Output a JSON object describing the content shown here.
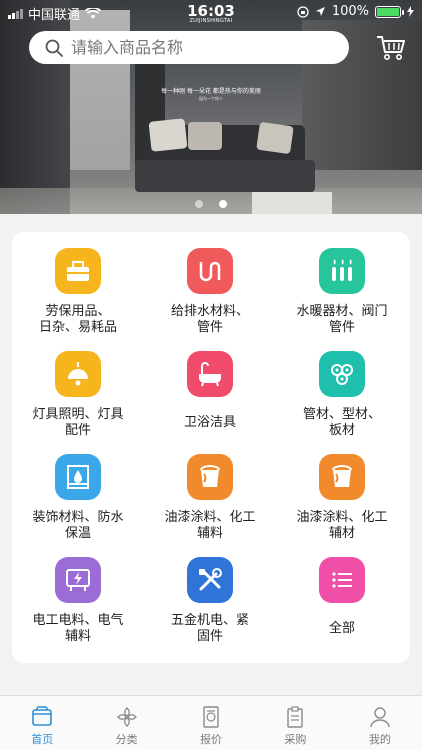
{
  "status_bar": {
    "carrier": "中国联通",
    "time": "16:03",
    "subtitle": "ZUIJINSHINGTAI",
    "battery": "100%"
  },
  "search": {
    "placeholder": "请输入商品名称"
  },
  "banner": {
    "caption_line1": "每一种刚 每一朵花 都是热与你的美丽",
    "caption_line2": "因为一个你人",
    "slides_total": 2,
    "active_slide": 2
  },
  "categories": [
    {
      "label": "劳保用品、\n日杂、易耗品",
      "icon": "toolbox-icon",
      "color": "#f7b51d"
    },
    {
      "label": "给排水材料、\n管件",
      "icon": "pipe-icon",
      "color": "#f05a5a"
    },
    {
      "label": "水暖器材、阀门\n管件",
      "icon": "radiator-icon",
      "color": "#27c59c"
    },
    {
      "label": "灯具照明、灯具\n配件",
      "icon": "lamp-icon",
      "color": "#f7b51d"
    },
    {
      "label": "卫浴洁具",
      "icon": "bathtub-icon",
      "color": "#f04b6a"
    },
    {
      "label": "管材、型材、\n板材",
      "icon": "pipes-bundle-icon",
      "color": "#1fbfae"
    },
    {
      "label": "装饰材料、防水\n保温",
      "icon": "panel-icon",
      "color": "#3aa8e8"
    },
    {
      "label": "油漆涂料、化工\n辅料",
      "icon": "paint-bucket-icon",
      "color": "#f08a2c"
    },
    {
      "label": "油漆涂料、化工\n辅材",
      "icon": "paint-bucket-icon",
      "color": "#f08a2c"
    },
    {
      "label": "电工电料、电气\n辅料",
      "icon": "electric-board-icon",
      "color": "#9b6bd6"
    },
    {
      "label": "五金机电、紧\n固件",
      "icon": "tools-icon",
      "color": "#2f74d6"
    },
    {
      "label": "全部",
      "icon": "list-icon",
      "color": "#f04fa8"
    }
  ],
  "nav": [
    {
      "label": "首页",
      "icon": "home-icon",
      "active": true
    },
    {
      "label": "分类",
      "icon": "category-icon",
      "active": false
    },
    {
      "label": "报价",
      "icon": "quote-icon",
      "active": false
    },
    {
      "label": "采购",
      "icon": "purchase-icon",
      "active": false
    },
    {
      "label": "我的",
      "icon": "profile-icon",
      "active": false
    }
  ]
}
